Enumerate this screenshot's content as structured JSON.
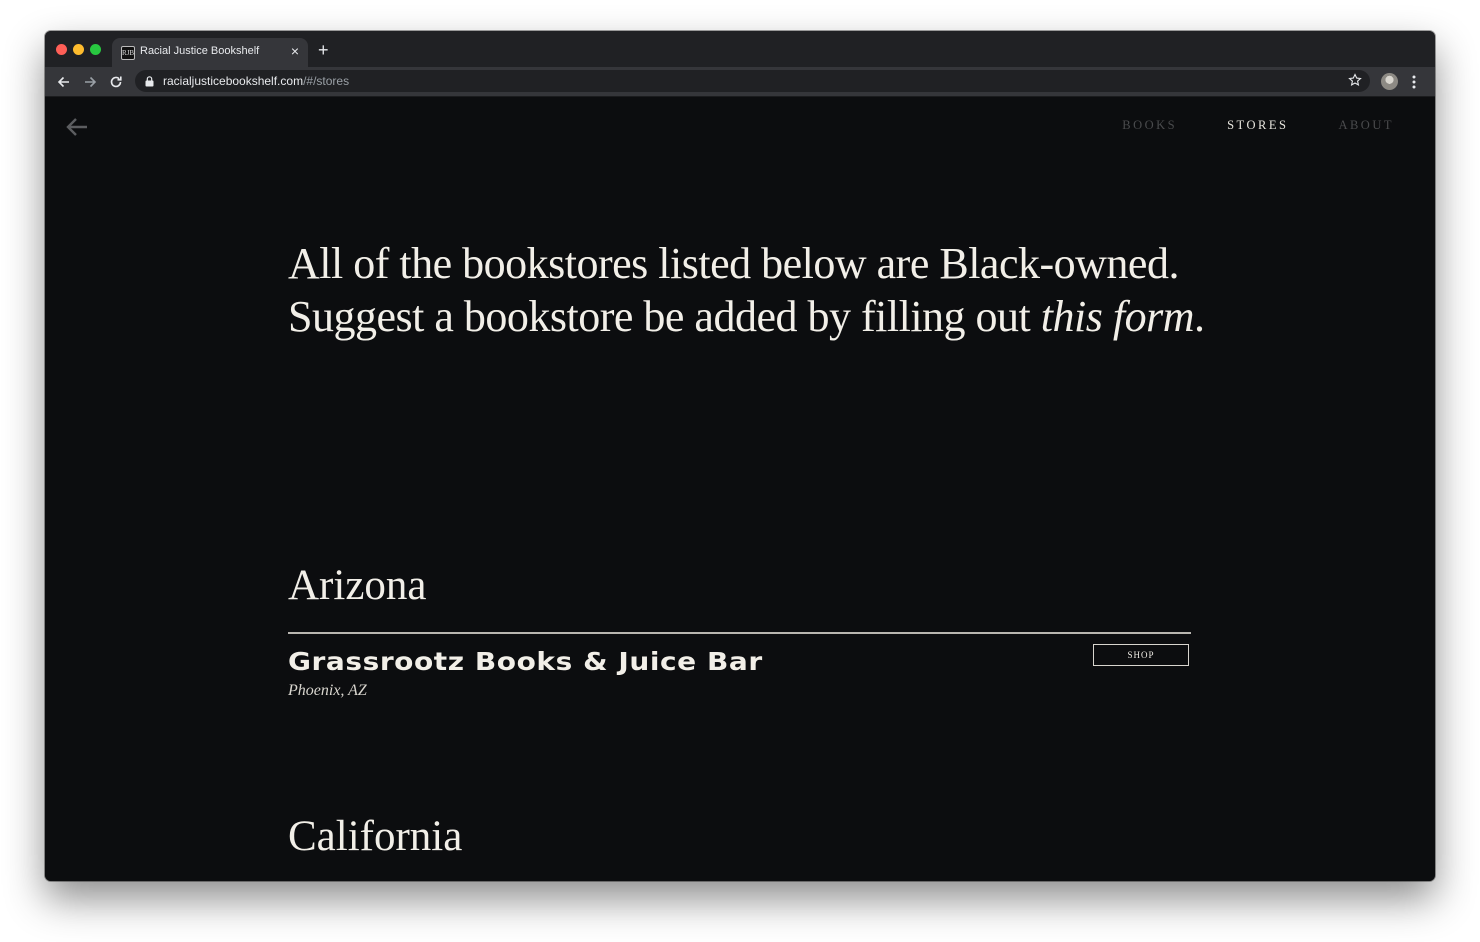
{
  "browser": {
    "tab_title": "Racial Justice Bookshelf",
    "tab_favicon_text": "RJB",
    "tab_close": "×",
    "new_tab": "+",
    "url_host": "racialjusticebookshelf.com",
    "url_path": "/#/stores"
  },
  "nav": {
    "books": "BOOKS",
    "stores": "STORES",
    "about": "ABOUT",
    "active": "STORES"
  },
  "intro": {
    "text": "All of the bookstores listed below are Black-owned. Suggest a bookstore be added by filling out ",
    "link_text": "this form",
    "end": "."
  },
  "sections": [
    {
      "state": "Arizona",
      "stores": [
        {
          "name": "Grassrootz Books & Juice Bar",
          "location": "Phoenix, AZ",
          "button": "SHOP"
        }
      ]
    },
    {
      "state": "California",
      "stores": []
    }
  ],
  "icons": {
    "back": "arrow-left-icon",
    "forward": "arrow-right-icon",
    "reload": "reload-icon",
    "lock": "lock-icon",
    "star": "star-icon",
    "menu": "more-vert-icon"
  }
}
